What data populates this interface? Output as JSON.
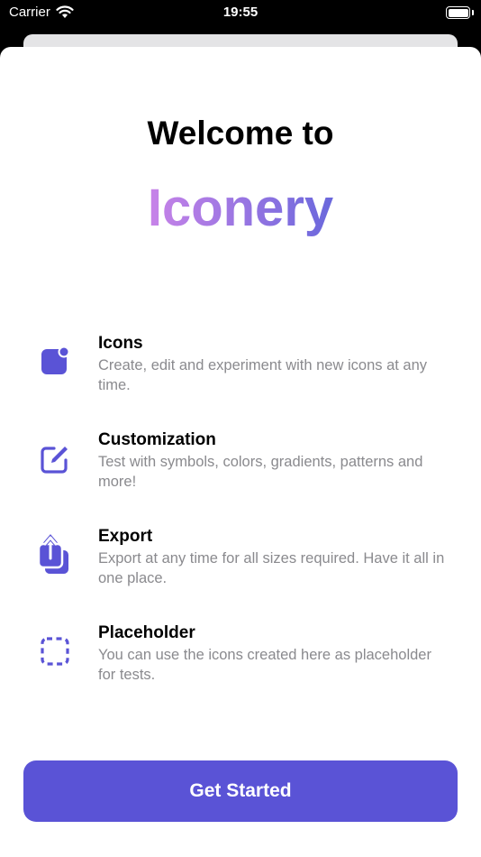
{
  "status_bar": {
    "carrier": "Carrier",
    "time": "19:55"
  },
  "welcome": {
    "line1": "Welcome to",
    "app_name": "Iconery"
  },
  "features": [
    {
      "title": "Icons",
      "description": "Create, edit and experiment with new icons at any time."
    },
    {
      "title": "Customization",
      "description": "Test with symbols, colors, gradients, patterns and more!"
    },
    {
      "title": "Export",
      "description": "Export at any time for all sizes required. Have it all in one place."
    },
    {
      "title": "Placeholder",
      "description": "You can use the icons created here as placeholder for tests."
    }
  ],
  "cta": {
    "label": "Get Started"
  },
  "colors": {
    "accent": "#5A53D6",
    "gradient_start": "#C883E8",
    "gradient_end": "#6A68DC"
  }
}
